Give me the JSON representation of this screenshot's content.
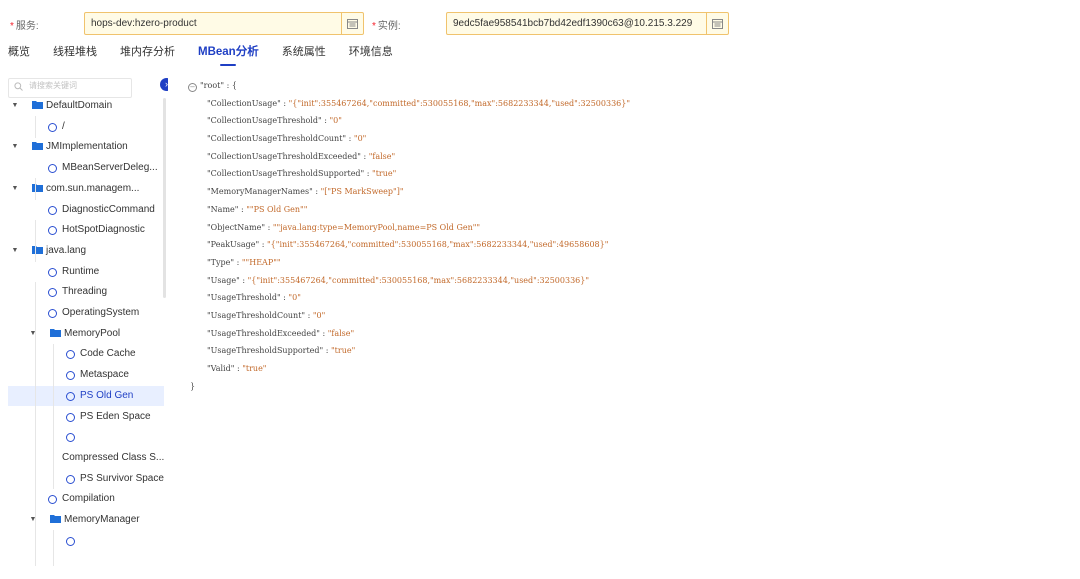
{
  "form": {
    "service_label": "服务:",
    "service_value": "hops-dev:hzero-product",
    "instance_label": "实例:",
    "instance_value": "9edc5fae958541bcb7bd42edf1390c63@10.215.3.229",
    "required_mark": "*",
    "lookup_icon": "lookup-icon"
  },
  "tabs": [
    {
      "label": "概览",
      "active": false
    },
    {
      "label": "线程堆栈",
      "active": false
    },
    {
      "label": "堆内存分析",
      "active": false
    },
    {
      "label": "MBean分析",
      "active": true
    },
    {
      "label": "系统属性",
      "active": false
    },
    {
      "label": "环境信息",
      "active": false
    }
  ],
  "accent_color": "#1f3fc4",
  "sidebar": {
    "search_placeholder": "请搜索关键词",
    "collapse_icon": "chevron-right-icon",
    "tree": [
      {
        "label": "DefaultDomain",
        "type": "folder",
        "depth": 0,
        "expanded": true
      },
      {
        "label": "/",
        "type": "leaf",
        "depth": 1
      },
      {
        "label": "JMImplementation",
        "type": "folder",
        "depth": 0,
        "expanded": true
      },
      {
        "label": "MBeanServerDeleg...",
        "type": "leaf",
        "depth": 1
      },
      {
        "label": "com.sun.managem...",
        "type": "folder",
        "depth": 0,
        "expanded": true
      },
      {
        "label": "DiagnosticCommand",
        "type": "leaf",
        "depth": 1
      },
      {
        "label": "HotSpotDiagnostic",
        "type": "leaf",
        "depth": 1
      },
      {
        "label": "java.lang",
        "type": "folder",
        "depth": 0,
        "expanded": true
      },
      {
        "label": "Runtime",
        "type": "leaf",
        "depth": 1
      },
      {
        "label": "Threading",
        "type": "leaf",
        "depth": 1
      },
      {
        "label": "OperatingSystem",
        "type": "leaf",
        "depth": 1
      },
      {
        "label": "MemoryPool",
        "type": "folder",
        "depth": 1,
        "expanded": true
      },
      {
        "label": "Code Cache",
        "type": "leaf",
        "depth": 2
      },
      {
        "label": "Metaspace",
        "type": "leaf",
        "depth": 2
      },
      {
        "label": "PS Old Gen",
        "type": "leaf",
        "depth": 2,
        "selected": true
      },
      {
        "label": "PS Eden Space",
        "type": "leaf",
        "depth": 2
      },
      {
        "label": "",
        "type": "leaf",
        "depth": 2
      },
      {
        "label": "Compressed Class S...",
        "type": "text",
        "depth": 2
      },
      {
        "label": "PS Survivor Space",
        "type": "leaf",
        "depth": 2
      },
      {
        "label": "Compilation",
        "type": "leaf",
        "depth": 1
      },
      {
        "label": "MemoryManager",
        "type": "folder",
        "depth": 1,
        "expanded": true
      },
      {
        "label": "",
        "type": "leaf",
        "depth": 2
      }
    ]
  },
  "json_view": {
    "root_key": "\"root\"",
    "open_brace": "{",
    "close_brace": "}",
    "entries": [
      {
        "key": "\"CollectionUsage\"",
        "value": "\"{\"init\":355467264,\"committed\":530055168,\"max\":5682233344,\"used\":32500336}\""
      },
      {
        "key": "\"CollectionUsageThreshold\"",
        "value": "\"0\""
      },
      {
        "key": "\"CollectionUsageThresholdCount\"",
        "value": "\"0\""
      },
      {
        "key": "\"CollectionUsageThresholdExceeded\"",
        "value": "\"false\""
      },
      {
        "key": "\"CollectionUsageThresholdSupported\"",
        "value": "\"true\""
      },
      {
        "key": "\"MemoryManagerNames\"",
        "value": "\"[\"PS MarkSweep\"]\""
      },
      {
        "key": "\"Name\"",
        "value": "\"\"PS Old Gen\"\""
      },
      {
        "key": "\"ObjectName\"",
        "value": "\"\"java.lang:type=MemoryPool,name=PS Old Gen\"\""
      },
      {
        "key": "\"PeakUsage\"",
        "value": "\"{\"init\":355467264,\"committed\":530055168,\"max\":5682233344,\"used\":49658608}\""
      },
      {
        "key": "\"Type\"",
        "value": "\"\"HEAP\"\""
      },
      {
        "key": "\"Usage\"",
        "value": "\"{\"init\":355467264,\"committed\":530055168,\"max\":5682233344,\"used\":32500336}\""
      },
      {
        "key": "\"UsageThreshold\"",
        "value": "\"0\""
      },
      {
        "key": "\"UsageThresholdCount\"",
        "value": "\"0\""
      },
      {
        "key": "\"UsageThresholdExceeded\"",
        "value": "\"false\""
      },
      {
        "key": "\"UsageThresholdSupported\"",
        "value": "\"true\""
      },
      {
        "key": "\"Valid\"",
        "value": "\"true\""
      }
    ]
  }
}
